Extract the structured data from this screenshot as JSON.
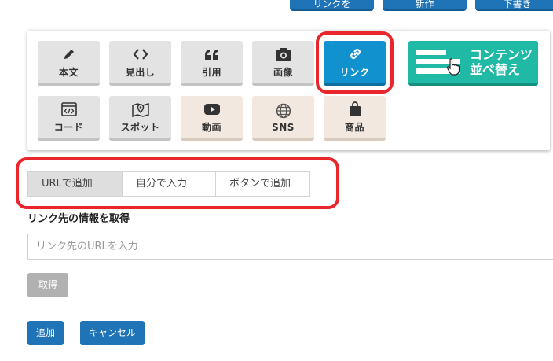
{
  "top_buttons": [
    "リンクを",
    "新作",
    "下書き"
  ],
  "insert_panel": {
    "tiles": [
      {
        "label": "本文",
        "icon": "pencil-icon"
      },
      {
        "label": "見出し",
        "icon": "angle-brackets-icon"
      },
      {
        "label": "引用",
        "icon": "quote-icon"
      },
      {
        "label": "画像",
        "icon": "camera-icon"
      },
      {
        "label": "リンク",
        "icon": "link-icon",
        "active": true
      },
      {
        "label": "コード",
        "icon": "code-window-icon"
      },
      {
        "label": "スポット",
        "icon": "map-pin-icon"
      },
      {
        "label": "動画",
        "icon": "play-icon"
      },
      {
        "label": "SNS",
        "icon": "globe-icon"
      },
      {
        "label": "商品",
        "icon": "shopping-bag-icon"
      }
    ],
    "sort_button": {
      "line1": "コンテンツ",
      "line2": "並べ替え"
    }
  },
  "tabs": [
    {
      "label": "URLで追加",
      "selected": true
    },
    {
      "label": "自分で入力",
      "selected": false
    },
    {
      "label": "ボタンで追加",
      "selected": false
    }
  ],
  "link_section": {
    "heading": "リンク先の情報を取得",
    "placeholder": "リンク先のURLを入力",
    "value": "",
    "fetch_label": "取得"
  },
  "footer": {
    "add_label": "追加",
    "cancel_label": "キャンセル"
  },
  "colors": {
    "primary": "#1f73b7",
    "active_tile": "#1192cf",
    "sort_teal": "#1fb9a5",
    "highlight_red": "#e8262b",
    "tile_gray": "#e3e3e3",
    "tile_beige": "#f2e8df",
    "disabled": "#b1b1b1"
  }
}
